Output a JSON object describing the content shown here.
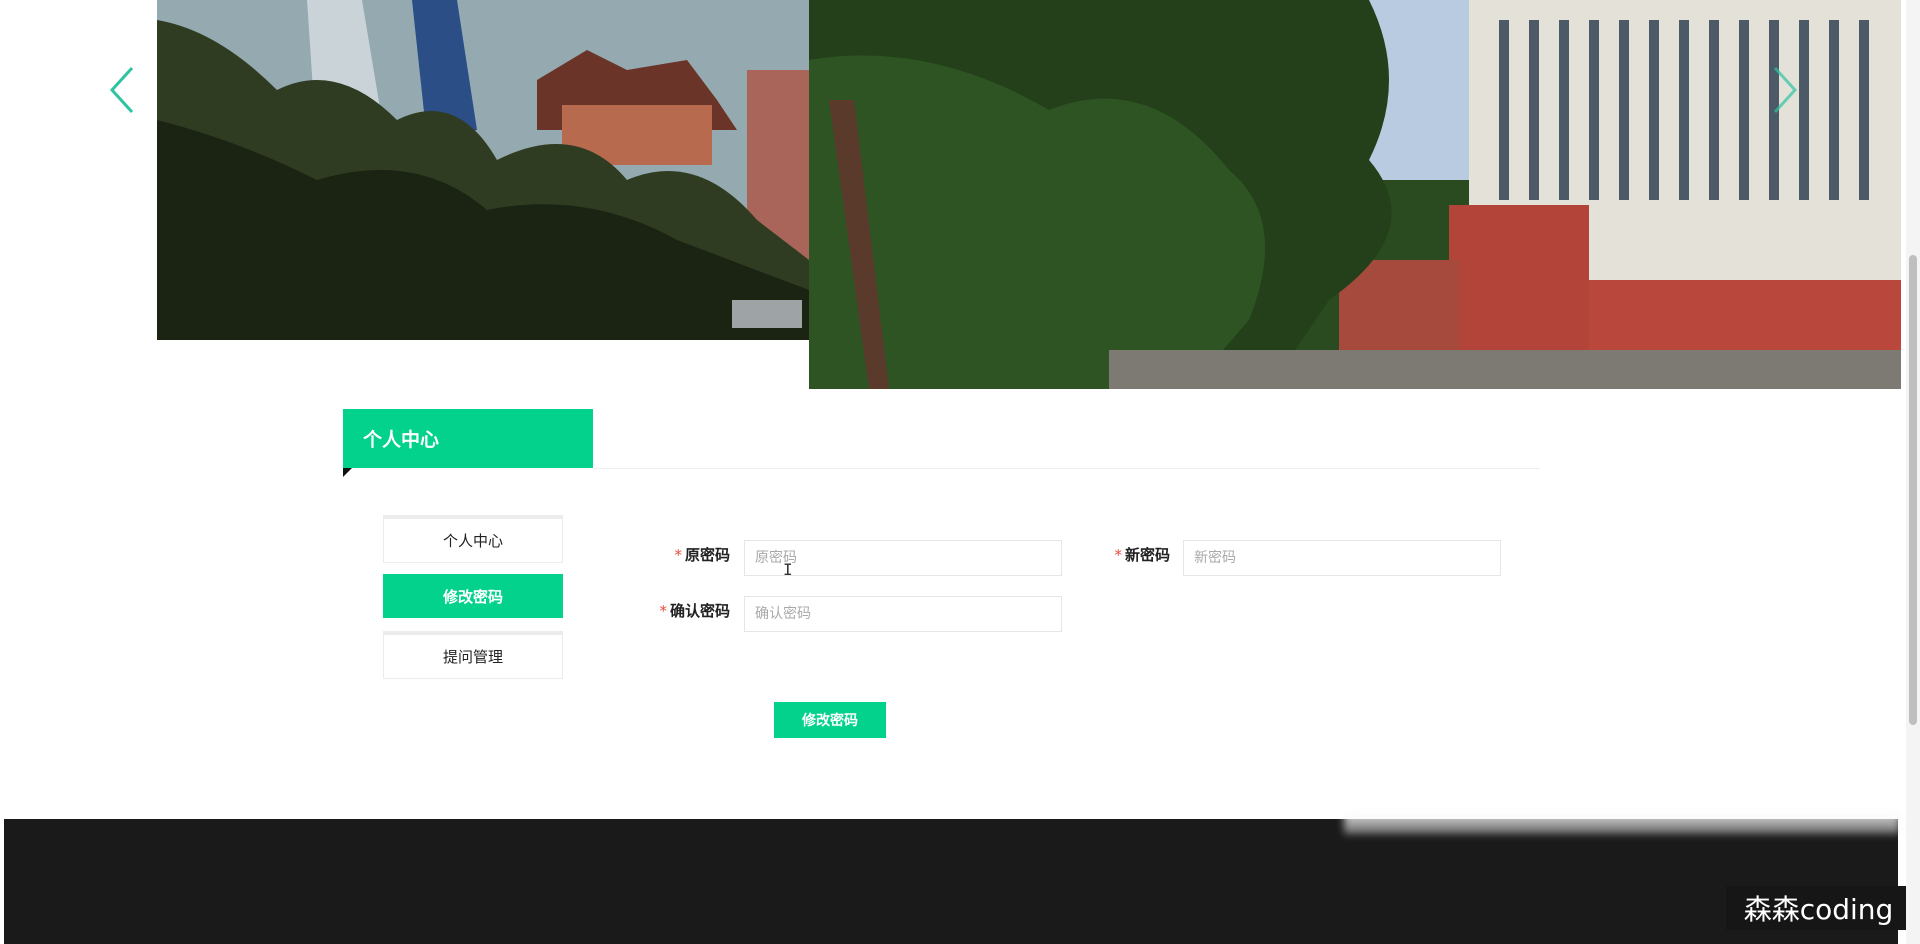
{
  "carousel": {
    "prev_icon": "chevron-left-icon",
    "next_icon": "chevron-right-icon",
    "accent": "#2ec4a0"
  },
  "section": {
    "title": "个人中心"
  },
  "side_menu": {
    "items": [
      {
        "label": "个人中心",
        "active": false
      },
      {
        "label": "修改密码",
        "active": true
      },
      {
        "label": "提问管理",
        "active": false
      }
    ]
  },
  "form": {
    "required_mark": "*",
    "old_password": {
      "label": "原密码",
      "placeholder": "原密码",
      "value": ""
    },
    "new_password": {
      "label": "新密码",
      "placeholder": "新密码",
      "value": ""
    },
    "confirm_password": {
      "label": "确认密码",
      "placeholder": "确认密码",
      "value": ""
    },
    "submit_label": "修改密码"
  },
  "watermark": {
    "text": "森森coding"
  },
  "colors": {
    "brand": "#03d28c",
    "footer": "#1a1a1a",
    "required": "#e74c3c"
  }
}
